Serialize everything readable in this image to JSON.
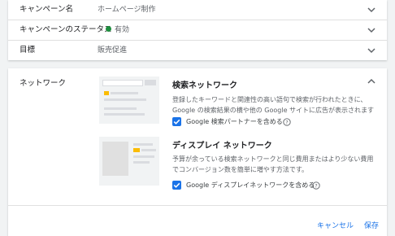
{
  "settings": {
    "rows": [
      {
        "label": "キャンペーン名",
        "value": "ホームページ制作"
      },
      {
        "label": "キャンペーンのステータス",
        "value": "有効"
      },
      {
        "label": "目標",
        "value": "販売促進"
      }
    ]
  },
  "network": {
    "label": "ネットワーク",
    "search": {
      "title": "検索ネットワーク",
      "description": "登録したキーワードと関連性の高い語句で検索が行われたときに、Google の検索結果の横や他の Google サイトに広告が表示されます",
      "checkbox_label": "Google 検索パートナーを含める",
      "checked": true
    },
    "display": {
      "title": "ディスプレイ ネットワーク",
      "description": "予算が余っている検索ネットワークと同じ費用またはより少ない費用でコンバージョン数を簡単に増やす方法です。",
      "checkbox_label": "Google ディスプレイネットワークを含める",
      "checked": true
    },
    "cancel_label": "キャンセル",
    "save_label": "保存"
  },
  "colors": {
    "accent": "#1a73e8",
    "status_green": "#1e8e3e",
    "thumb_highlight": "#fbbc04"
  }
}
